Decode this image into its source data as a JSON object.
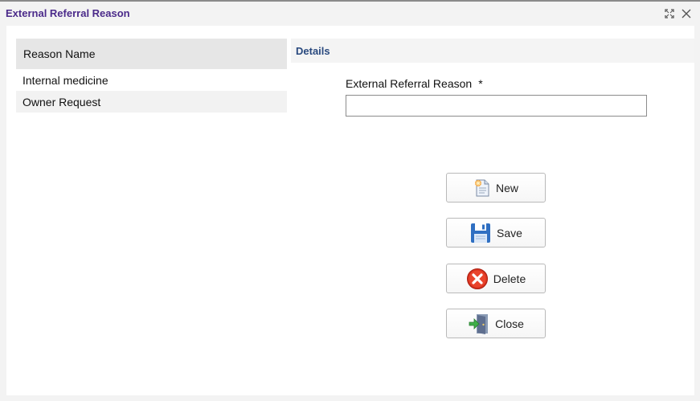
{
  "window": {
    "title": "External Referral Reason",
    "maximize_icon": "expand-icon",
    "close_icon": "close-icon"
  },
  "list": {
    "header": "Reason Name",
    "rows": [
      "Internal medicine",
      "Owner Request"
    ]
  },
  "details": {
    "heading": "Details",
    "field_label": "External Referral Reason",
    "required_mark": "*",
    "field_value": ""
  },
  "buttons": {
    "new": "New",
    "save": "Save",
    "delete": "Delete",
    "close": "Close"
  },
  "colors": {
    "title": "#4b2a8a",
    "details_heading": "#2a4a7f",
    "list_header_bg": "#e6e6e6"
  }
}
